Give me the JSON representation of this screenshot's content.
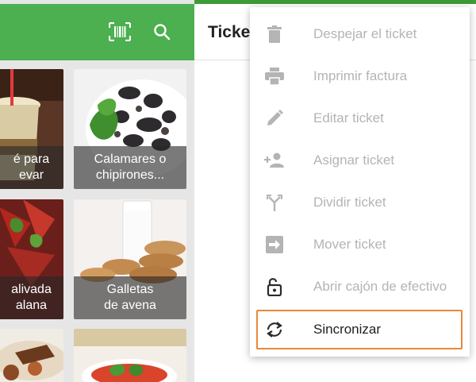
{
  "header": {
    "ticket_title": "Ticke"
  },
  "colors": {
    "brand_green": "#4caf50",
    "highlight_orange": "#e8883a"
  },
  "toolbar_icons": [
    "barcode-icon",
    "search-icon"
  ],
  "products": [
    {
      "name": "é para\nevar"
    },
    {
      "name": "Calamares o\nchipirones..."
    },
    {
      "name": "alivada\nalana"
    },
    {
      "name": "Galletas\nde avena"
    },
    {
      "name": ""
    },
    {
      "name": ""
    }
  ],
  "menu": {
    "items": [
      {
        "label": "Despejar el ticket",
        "icon": "trash-icon",
        "enabled": false
      },
      {
        "label": "Imprimir factura",
        "icon": "printer-icon",
        "enabled": false
      },
      {
        "label": "Editar ticket",
        "icon": "pencil-icon",
        "enabled": false
      },
      {
        "label": "Asignar ticket",
        "icon": "assign-user-icon",
        "enabled": false
      },
      {
        "label": "Dividir ticket",
        "icon": "split-icon",
        "enabled": false
      },
      {
        "label": "Mover ticket",
        "icon": "move-icon",
        "enabled": false
      },
      {
        "label": "Abrir cajón de efectivo",
        "icon": "unlock-icon",
        "enabled": true
      },
      {
        "label": "Sincronizar",
        "icon": "sync-icon",
        "enabled": true,
        "highlighted": true
      }
    ]
  }
}
